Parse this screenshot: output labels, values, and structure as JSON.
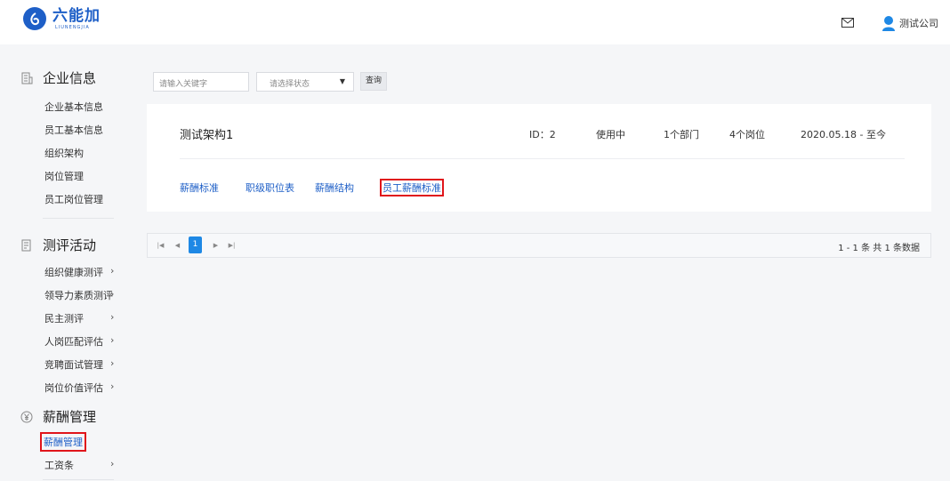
{
  "header": {
    "logo_text": "六能加",
    "logo_subtext": "LIUNENGJIA",
    "user_name": "测试公司"
  },
  "sidebar": {
    "groups": [
      {
        "label": "企业信息",
        "icon": "building-icon"
      },
      {
        "label": "测评活动",
        "icon": "clipboard-icon"
      },
      {
        "label": "薪酬管理",
        "icon": "yen-circle-icon"
      }
    ],
    "company_items": [
      "企业基本信息",
      "员工基本信息",
      "组织架构",
      "岗位管理",
      "员工岗位管理"
    ],
    "assessment_items": [
      "组织健康测评",
      "领导力素质测评",
      "民主测评",
      "人岗匹配评估",
      "竞聘面试管理",
      "岗位价值评估"
    ],
    "salary_items": [
      "薪酬管理",
      "工资条"
    ]
  },
  "filters": {
    "search_placeholder": "请输入关键字",
    "status_placeholder": "请选择状态",
    "query_label": "查询"
  },
  "card": {
    "title": "测试架构1",
    "id": "ID：2",
    "status": "使用中",
    "departments": "1个部门",
    "positions": "4个岗位",
    "date_range": "2020.05.18 - 至今",
    "links": [
      "薪酬标准",
      "职级职位表",
      "薪酬结构",
      "员工薪酬标准"
    ]
  },
  "pagination": {
    "current_page": "1",
    "summary": "1 - 1 条  共 1 条数据"
  },
  "colors": {
    "brand": "#1e5fc7",
    "highlight": "#e0151b",
    "page_active": "#1e88e5"
  }
}
